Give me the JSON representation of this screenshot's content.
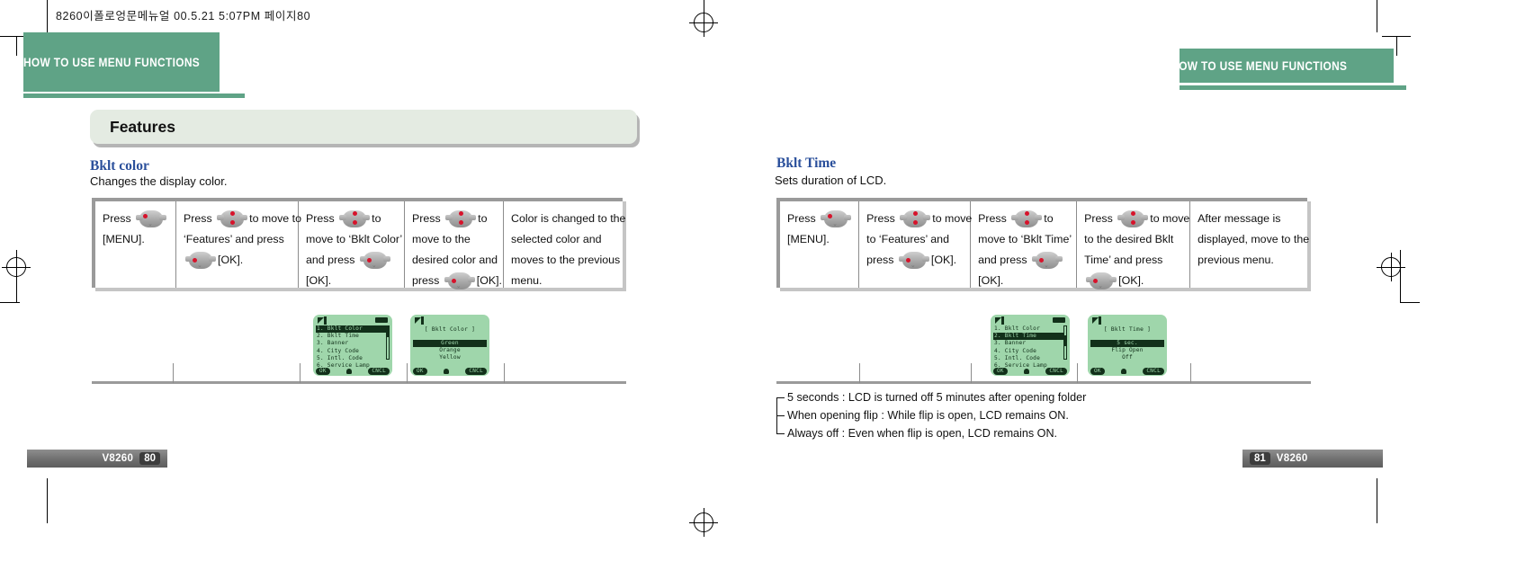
{
  "imprint": "8260이폴로엉문메뉴얼   00.5.21 5:07PM 페이지80",
  "colors": {
    "chapter_green": "#5fa386",
    "section_blue": "#2a4f9b",
    "lcd_green": "#9fd6ab",
    "key_red": "#d7132b",
    "banner_gray": "#e4ebe2"
  },
  "left_page": {
    "chapter": "HOW TO USE MENU FUNCTIONS",
    "banner": "Features",
    "section_title": "Bklt color",
    "section_sub": "Changes the display color.",
    "steps": [
      {
        "lines": [
          "Press [KEY]",
          "[MENU]."
        ]
      },
      {
        "lines": [
          "Press [KEY] to move to",
          "‘Features’ and press",
          "[KEY] [OK]."
        ]
      },
      {
        "lines": [
          "Press [KEY] to",
          "move to ‘Bklt Color’",
          "and  press [KEY]",
          "[OK]."
        ]
      },
      {
        "lines": [
          "Press [KEY] to",
          "move to the",
          "desired color and",
          "press [KEY] [OK]."
        ]
      },
      {
        "lines": [
          "Color is changed to the",
          "selected color and",
          "moves to the previous",
          "menu."
        ]
      }
    ],
    "lcd_menu": {
      "items": [
        "1.  Bklt  Color",
        "2.  Bklt  Time",
        "3.  Banner",
        "4.  City  Code",
        "5.  Intl.  Code",
        "6.  Service Lamp"
      ],
      "selected_index": 0,
      "softkey_left": "OK",
      "softkey_right": "CNCL"
    },
    "lcd_color": {
      "title": "[  Bklt  Color  ]",
      "items": [
        "Green",
        "Orange",
        "Yellow"
      ],
      "selected_index": 0,
      "softkey_left": "OK",
      "softkey_right": "CNCL"
    },
    "footer_model": "V8260",
    "footer_page": "80"
  },
  "right_page": {
    "chapter": "HOW TO USE MENU FUNCTIONS",
    "section_title": "Bklt Time",
    "section_sub": "Sets duration of LCD.",
    "steps": [
      {
        "lines": [
          "Press [KEY]",
          "[MENU]."
        ]
      },
      {
        "lines": [
          "Press [KEY] to move",
          "to  ‘Features’  and",
          "press [KEY] [OK]."
        ]
      },
      {
        "lines": [
          "Press [KEY] to",
          "move to ‘Bklt Time’",
          "and press [KEY]",
          "[OK]."
        ]
      },
      {
        "lines": [
          "Press [KEY] to move",
          "to the desired  Bklt",
          "Time’ and press",
          "[KEY] [OK]."
        ]
      },
      {
        "lines": [
          "After message is",
          "displayed, move to the",
          "previous menu."
        ]
      }
    ],
    "lcd_menu": {
      "items": [
        "1.  Bklt  Color",
        "2.  Bklt  Time",
        "3.  Banner",
        "4.  City  Code",
        "5.  Intl.  Code",
        "6.  Service Lamp"
      ],
      "selected_index": 1,
      "softkey_left": "OK",
      "softkey_right": "CNCL"
    },
    "lcd_time": {
      "title": "[  Bklt  Time  ]",
      "items": [
        "5 sec.",
        "Flip  Open",
        "Off"
      ],
      "selected_index": 0,
      "softkey_left": "OK",
      "softkey_right": "CNCL"
    },
    "notes": [
      "5 seconds : LCD is turned off 5 minutes after opening folder",
      "When opening flip : While flip is open, LCD remains ON.",
      "Always off : Even when flip is open, LCD remains ON."
    ],
    "footer_page": "81",
    "footer_model": "V8260"
  }
}
